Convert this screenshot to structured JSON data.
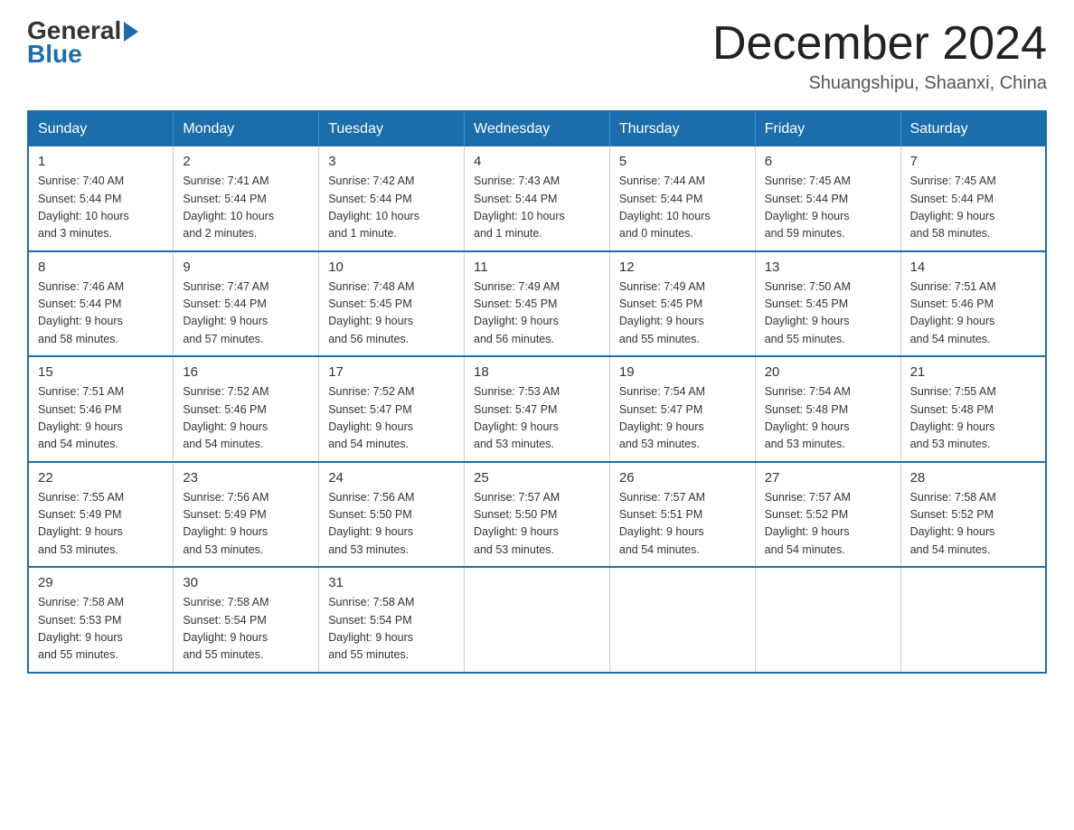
{
  "header": {
    "logo_general": "General",
    "logo_blue": "Blue",
    "month_title": "December 2024",
    "location": "Shuangshipu, Shaanxi, China"
  },
  "weekdays": [
    "Sunday",
    "Monday",
    "Tuesday",
    "Wednesday",
    "Thursday",
    "Friday",
    "Saturday"
  ],
  "weeks": [
    [
      {
        "day": "1",
        "info": "Sunrise: 7:40 AM\nSunset: 5:44 PM\nDaylight: 10 hours\nand 3 minutes."
      },
      {
        "day": "2",
        "info": "Sunrise: 7:41 AM\nSunset: 5:44 PM\nDaylight: 10 hours\nand 2 minutes."
      },
      {
        "day": "3",
        "info": "Sunrise: 7:42 AM\nSunset: 5:44 PM\nDaylight: 10 hours\nand 1 minute."
      },
      {
        "day": "4",
        "info": "Sunrise: 7:43 AM\nSunset: 5:44 PM\nDaylight: 10 hours\nand 1 minute."
      },
      {
        "day": "5",
        "info": "Sunrise: 7:44 AM\nSunset: 5:44 PM\nDaylight: 10 hours\nand 0 minutes."
      },
      {
        "day": "6",
        "info": "Sunrise: 7:45 AM\nSunset: 5:44 PM\nDaylight: 9 hours\nand 59 minutes."
      },
      {
        "day": "7",
        "info": "Sunrise: 7:45 AM\nSunset: 5:44 PM\nDaylight: 9 hours\nand 58 minutes."
      }
    ],
    [
      {
        "day": "8",
        "info": "Sunrise: 7:46 AM\nSunset: 5:44 PM\nDaylight: 9 hours\nand 58 minutes."
      },
      {
        "day": "9",
        "info": "Sunrise: 7:47 AM\nSunset: 5:44 PM\nDaylight: 9 hours\nand 57 minutes."
      },
      {
        "day": "10",
        "info": "Sunrise: 7:48 AM\nSunset: 5:45 PM\nDaylight: 9 hours\nand 56 minutes."
      },
      {
        "day": "11",
        "info": "Sunrise: 7:49 AM\nSunset: 5:45 PM\nDaylight: 9 hours\nand 56 minutes."
      },
      {
        "day": "12",
        "info": "Sunrise: 7:49 AM\nSunset: 5:45 PM\nDaylight: 9 hours\nand 55 minutes."
      },
      {
        "day": "13",
        "info": "Sunrise: 7:50 AM\nSunset: 5:45 PM\nDaylight: 9 hours\nand 55 minutes."
      },
      {
        "day": "14",
        "info": "Sunrise: 7:51 AM\nSunset: 5:46 PM\nDaylight: 9 hours\nand 54 minutes."
      }
    ],
    [
      {
        "day": "15",
        "info": "Sunrise: 7:51 AM\nSunset: 5:46 PM\nDaylight: 9 hours\nand 54 minutes."
      },
      {
        "day": "16",
        "info": "Sunrise: 7:52 AM\nSunset: 5:46 PM\nDaylight: 9 hours\nand 54 minutes."
      },
      {
        "day": "17",
        "info": "Sunrise: 7:52 AM\nSunset: 5:47 PM\nDaylight: 9 hours\nand 54 minutes."
      },
      {
        "day": "18",
        "info": "Sunrise: 7:53 AM\nSunset: 5:47 PM\nDaylight: 9 hours\nand 53 minutes."
      },
      {
        "day": "19",
        "info": "Sunrise: 7:54 AM\nSunset: 5:47 PM\nDaylight: 9 hours\nand 53 minutes."
      },
      {
        "day": "20",
        "info": "Sunrise: 7:54 AM\nSunset: 5:48 PM\nDaylight: 9 hours\nand 53 minutes."
      },
      {
        "day": "21",
        "info": "Sunrise: 7:55 AM\nSunset: 5:48 PM\nDaylight: 9 hours\nand 53 minutes."
      }
    ],
    [
      {
        "day": "22",
        "info": "Sunrise: 7:55 AM\nSunset: 5:49 PM\nDaylight: 9 hours\nand 53 minutes."
      },
      {
        "day": "23",
        "info": "Sunrise: 7:56 AM\nSunset: 5:49 PM\nDaylight: 9 hours\nand 53 minutes."
      },
      {
        "day": "24",
        "info": "Sunrise: 7:56 AM\nSunset: 5:50 PM\nDaylight: 9 hours\nand 53 minutes."
      },
      {
        "day": "25",
        "info": "Sunrise: 7:57 AM\nSunset: 5:50 PM\nDaylight: 9 hours\nand 53 minutes."
      },
      {
        "day": "26",
        "info": "Sunrise: 7:57 AM\nSunset: 5:51 PM\nDaylight: 9 hours\nand 54 minutes."
      },
      {
        "day": "27",
        "info": "Sunrise: 7:57 AM\nSunset: 5:52 PM\nDaylight: 9 hours\nand 54 minutes."
      },
      {
        "day": "28",
        "info": "Sunrise: 7:58 AM\nSunset: 5:52 PM\nDaylight: 9 hours\nand 54 minutes."
      }
    ],
    [
      {
        "day": "29",
        "info": "Sunrise: 7:58 AM\nSunset: 5:53 PM\nDaylight: 9 hours\nand 55 minutes."
      },
      {
        "day": "30",
        "info": "Sunrise: 7:58 AM\nSunset: 5:54 PM\nDaylight: 9 hours\nand 55 minutes."
      },
      {
        "day": "31",
        "info": "Sunrise: 7:58 AM\nSunset: 5:54 PM\nDaylight: 9 hours\nand 55 minutes."
      },
      {
        "day": "",
        "info": ""
      },
      {
        "day": "",
        "info": ""
      },
      {
        "day": "",
        "info": ""
      },
      {
        "day": "",
        "info": ""
      }
    ]
  ]
}
